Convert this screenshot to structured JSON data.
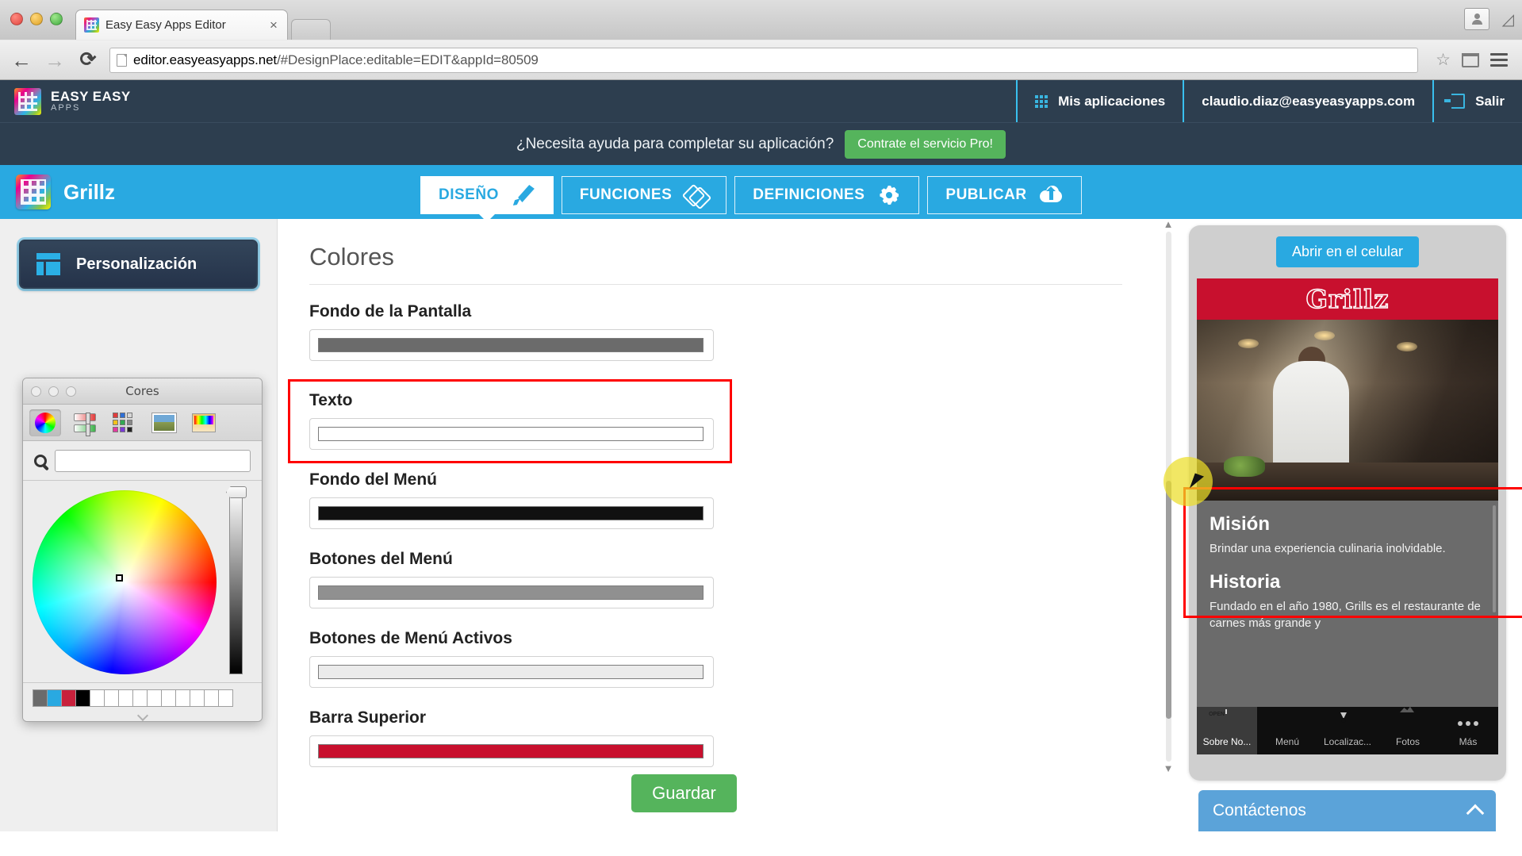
{
  "browser": {
    "tab_title": "Easy Easy Apps Editor",
    "tab_close": "×",
    "url_host": "editor.easyeasyapps.net",
    "url_path": "/#DesignPlace:editable=EDIT&appId=80509",
    "back_icon": "←",
    "forward_icon": "→",
    "reload_icon": "⟳",
    "star_icon": "☆"
  },
  "topbar": {
    "brand_line1": "EASY EASY",
    "brand_line2": "APPS",
    "my_apps": "Mis aplicaciones",
    "user_email": "claudio.diaz@easyeasyapps.com",
    "logout": "Salir"
  },
  "promo": {
    "text": "¿Necesita ayuda para completar su aplicación?",
    "button": "Contrate el servicio Pro!"
  },
  "app_header": {
    "app_name": "Grillz",
    "tabs": [
      {
        "label": "DISEÑO",
        "icon": "brush-icon",
        "active": true
      },
      {
        "label": "FUNCIONES",
        "icon": "tag-icon",
        "active": false
      },
      {
        "label": "DEFINICIONES",
        "icon": "gear-icon",
        "active": false
      },
      {
        "label": "PUBLICAR",
        "icon": "cloud-upload-icon",
        "active": false
      }
    ]
  },
  "sidebar": {
    "button_label": "Personalización"
  },
  "color_picker": {
    "title": "Cores",
    "search_value": "",
    "tools": [
      "color-wheel-icon",
      "color-sliders-icon",
      "color-palettes-icon",
      "image-palette-icon",
      "crayons-icon"
    ],
    "swatches": [
      "#6b6b6b",
      "#29a9e1",
      "#c8213c",
      "#000000",
      "#ffffff",
      "#ffffff",
      "#ffffff",
      "#ffffff",
      "#ffffff",
      "#ffffff",
      "#ffffff",
      "#ffffff",
      "#ffffff",
      "#ffffff"
    ]
  },
  "main": {
    "section_title": "Colores",
    "fields": [
      {
        "label": "Fondo de la Pantalla",
        "color": "#6b6b6b",
        "highlighted": false
      },
      {
        "label": "Texto",
        "color": "#ffffff",
        "highlighted": true
      },
      {
        "label": "Fondo del Menú",
        "color": "#111111",
        "highlighted": false
      },
      {
        "label": "Botones del Menú",
        "color": "#909090",
        "highlighted": false
      },
      {
        "label": "Botones de Menú Activos",
        "color": "#ebebeb",
        "highlighted": false
      },
      {
        "label": "Barra Superior",
        "color": "#c8102e",
        "highlighted": false
      }
    ],
    "save_button": "Guardar"
  },
  "preview": {
    "open_mobile_button": "Abrir en el celular",
    "app_logo": "Grillz",
    "sections": [
      {
        "heading": "Misión",
        "body": "Brindar una experiencia culinaria inolvidable."
      },
      {
        "heading": "Historia",
        "body": "Fundado en el año 1980, Grills es el restaurante de carnes más grande y"
      }
    ],
    "tabs": [
      {
        "label": "Sobre No...",
        "icon": "open-sign-icon",
        "selected": true
      },
      {
        "label": "Menú",
        "icon": "book-icon",
        "selected": false
      },
      {
        "label": "Localizac...",
        "icon": "map-pin-icon",
        "selected": false
      },
      {
        "label": "Fotos",
        "icon": "photos-icon",
        "selected": false
      },
      {
        "label": "Más",
        "icon": "ellipsis-icon",
        "selected": false
      }
    ],
    "contact_bar": "Contáctenos"
  }
}
